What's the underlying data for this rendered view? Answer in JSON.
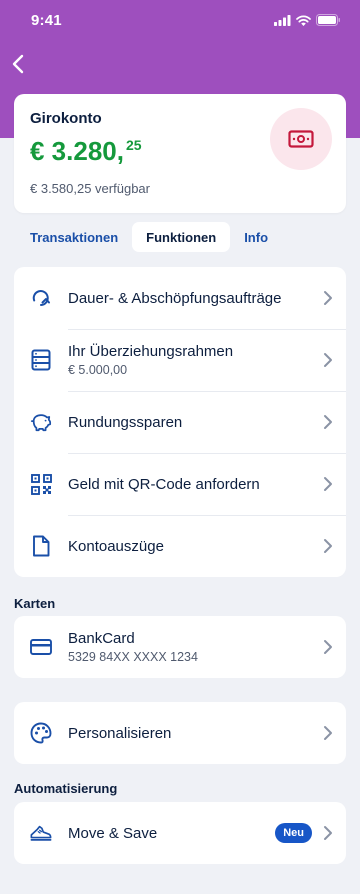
{
  "status": {
    "time": "9:41"
  },
  "account": {
    "name": "Girokonto",
    "balance_main": "€ 3.280,",
    "balance_cents": "25",
    "available": "€ 3.580,25 verfügbar",
    "icon": "banknote-icon"
  },
  "tabs": [
    {
      "label": "Transaktionen",
      "active": false
    },
    {
      "label": "Funktionen",
      "active": true
    },
    {
      "label": "Info",
      "active": false
    }
  ],
  "functions": [
    {
      "title": "Dauer- & Abschöpfungsaufträge",
      "icon": "repeat-icon"
    },
    {
      "title": "Ihr Überziehungsrahmen",
      "subtitle": "€ 5.000,00",
      "icon": "overdraft-icon"
    },
    {
      "title": "Rundungssparen",
      "icon": "piggy-bank-icon"
    },
    {
      "title": "Geld mit QR-Code anfordern",
      "icon": "qr-code-icon"
    },
    {
      "title": "Kontoauszüge",
      "icon": "document-icon"
    }
  ],
  "cards_section": {
    "label": "Karten",
    "card_title": "BankCard",
    "card_number": "5329 84XX XXXX 1234",
    "icon": "credit-card-icon"
  },
  "personalize": {
    "title": "Personalisieren",
    "icon": "palette-icon"
  },
  "automation": {
    "label": "Automatisierung",
    "title": "Move & Save",
    "badge": "Neu",
    "icon": "sneaker-icon"
  },
  "colors": {
    "header": "#9e4fbe",
    "balance_green": "#15993c",
    "link_blue": "#1a4fa8",
    "badge_blue": "#1756c7",
    "icon_bg_pink": "#fbe6ec",
    "icon_red": "#c4183c"
  }
}
